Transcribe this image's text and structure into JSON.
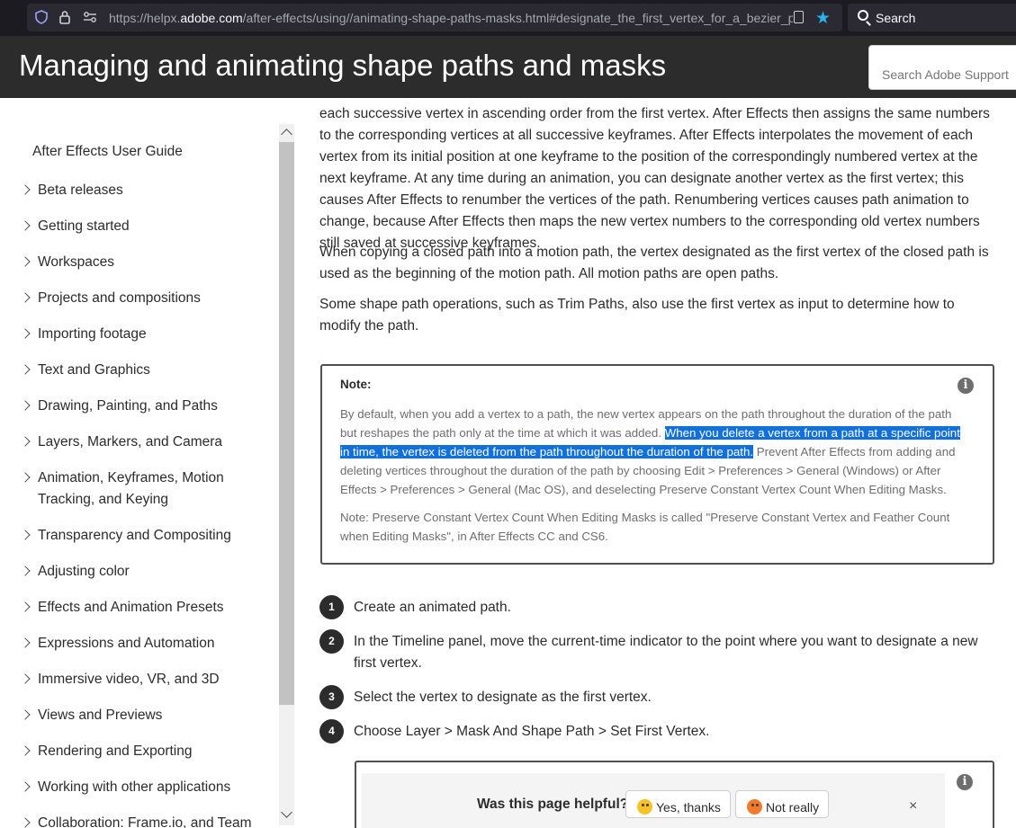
{
  "browser": {
    "url_prefix": "https://helpx.",
    "url_domain": "adobe.com",
    "url_path": "/after-effects/using//animating-shape-paths-masks.html#designate_the_first_vertex_for_a_bezier_p",
    "search_label": "Search"
  },
  "header": {
    "title": "Managing and animating shape paths and masks",
    "search_placeholder": "Search Adobe Support"
  },
  "sidebar": {
    "guide_title": "After Effects User Guide",
    "items": [
      "Beta releases",
      "Getting started",
      "Workspaces",
      "Projects and compositions",
      "Importing footage",
      "Text and Graphics",
      "Drawing, Painting, and Paths",
      "Layers, Markers, and Camera",
      "Animation, Keyframes, Motion Tracking, and Keying",
      "Transparency and Compositing",
      "Adjusting color",
      "Effects and Animation Presets",
      "Expressions and Automation",
      "Immersive video, VR, and 3D",
      "Views and Previews",
      "Rendering and Exporting",
      "Working with other applications",
      "Collaboration: Frame.io, and Team"
    ]
  },
  "content": {
    "para1": "each successive vertex in ascending order from the first vertex. After Effects then assigns the same numbers to the corresponding vertices at all successive keyframes. After Effects interpolates the movement of each vertex from its initial position at one keyframe to the position of the correspondingly numbered vertex at the next keyframe. At any time during an animation, you can designate another vertex as the first vertex; this causes After Effects to renumber the vertices of the path. Renumbering vertices causes path animation to change, because After Effects then maps the new vertex numbers to the corresponding old vertex numbers still saved at successive keyframes.",
    "para2": "When copying a closed path into a motion path, the vertex designated as the first vertex of the closed path is used as the beginning of the motion path. All motion paths are open paths.",
    "para3": "Some shape path operations, such as Trim Paths, also use the first vertex as input to determine how to modify the path.",
    "note": {
      "label": "Note:",
      "text_before": "By default, when you add a vertex to a path, the new vertex appears on the path throughout the duration of the path but reshapes the path only at the time at which it was added. ",
      "text_highlight": "When you delete a vertex from a path at a specific point in time, the vertex is deleted from the path throughout the duration of the path.",
      "text_after": " Prevent After Effects from adding and deleting vertices throughout the duration of the path by choosing Edit > Preferences > General (Windows) or After Effects > Preferences > General (Mac OS), and deselecting Preserve Constant Vertex Count When Editing Masks.",
      "text2": "Note: Preserve Constant Vertex Count When Editing Masks is called \"Preserve Constant Vertex and Feather Count when Editing Masks\", in After Effects CC and CS6."
    },
    "steps": [
      {
        "num": "1",
        "text": "Create an animated path."
      },
      {
        "num": "2",
        "text": "In the Timeline panel, move the current-time indicator to the point where you want to designate a new first vertex."
      },
      {
        "num": "3",
        "text": "Select the vertex to designate as the first vertex."
      },
      {
        "num": "4",
        "text": "Choose Layer > Mask And Shape Path > Set First Vertex."
      }
    ]
  },
  "feedback": {
    "question": "Was this page helpful?",
    "yes": "Yes, thanks",
    "no": "Not really",
    "close": "×"
  }
}
